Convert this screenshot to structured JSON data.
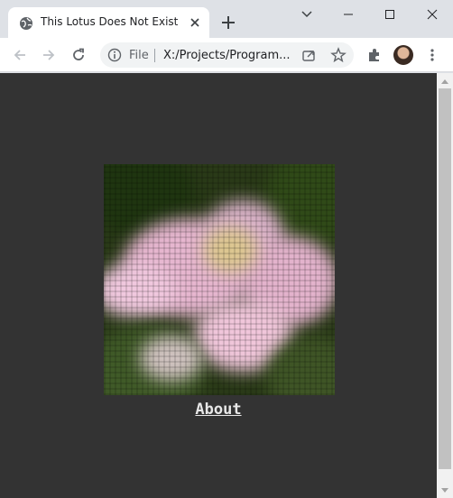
{
  "tab": {
    "title": "This Lotus Does Not Exist",
    "favicon": "globe-icon"
  },
  "omnibox": {
    "security_label": "File",
    "url": "X:/Projects/Program..."
  },
  "page": {
    "about_link": "About",
    "background_color": "#333333",
    "link_color": "#e8e8e8"
  }
}
